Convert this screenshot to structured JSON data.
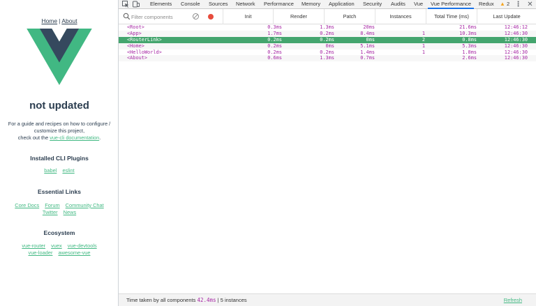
{
  "app": {
    "nav": {
      "home": "Home",
      "separator": "|",
      "about": "About"
    },
    "title": "not updated",
    "guide_line1": "For a guide and recipes on how to configure /",
    "guide_line2": "customize this project,",
    "guide_line3_prefix": "check out the",
    "guide_link": "vue-cli documentation",
    "guide_line3_suffix": ".",
    "plugins_heading": "Installed CLI Plugins",
    "plugins": [
      "babel",
      "eslint"
    ],
    "essential_heading": "Essential Links",
    "essential_row1": [
      "Core Docs",
      "Forum",
      "Community Chat"
    ],
    "essential_row2": [
      "Twitter",
      "News"
    ],
    "ecosystem_heading": "Ecosystem",
    "ecosystem_row1": [
      "vue-router",
      "vuex",
      "vue-devtools"
    ],
    "ecosystem_row2": [
      "vue-loader",
      "awesome-vue"
    ],
    "logo_colors": {
      "outer": "#41b883",
      "inner": "#35495e"
    }
  },
  "devtools": {
    "tabs": [
      "Elements",
      "Console",
      "Sources",
      "Network",
      "Performance",
      "Memory",
      "Application",
      "Security",
      "Audits",
      "Vue",
      "Vue Performance",
      "Redux"
    ],
    "active_tab": "Vue Performance",
    "warning_count": "2",
    "toolbar": {
      "filter_placeholder": "Filter components",
      "columns": [
        "Init",
        "Render",
        "Patch",
        "Instances",
        "Total Time (ms)",
        "Last Update"
      ]
    },
    "rows": [
      {
        "name": "<Root>",
        "init": "0.3ms",
        "render": "1.3ms",
        "patch": "20ms",
        "instances": "",
        "total": "21.6ms",
        "last": "12:46:12",
        "selected": false
      },
      {
        "name": "<App>",
        "init": "1.7ms",
        "render": "0.2ms",
        "patch": "8.4ms",
        "instances": "1",
        "total": "10.3ms",
        "last": "12:46:30",
        "selected": false
      },
      {
        "name": "<RouterLink>",
        "init": "0.2ms",
        "render": "0.2ms",
        "patch": "0ms",
        "instances": "2",
        "total": "0.8ms",
        "last": "12:46:30",
        "selected": true
      },
      {
        "name": "<Home>",
        "init": "0.2ms",
        "render": "0ms",
        "patch": "5.1ms",
        "instances": "1",
        "total": "5.3ms",
        "last": "12:46:30",
        "selected": false
      },
      {
        "name": "<HelloWorld>",
        "init": "0.2ms",
        "render": "0.2ms",
        "patch": "1.4ms",
        "instances": "1",
        "total": "1.8ms",
        "last": "12:46:30",
        "selected": false
      },
      {
        "name": "<About>",
        "init": "0.6ms",
        "render": "1.3ms",
        "patch": "0.7ms",
        "instances": "",
        "total": "2.6ms",
        "last": "12:46:30",
        "selected": false
      }
    ],
    "status": {
      "prefix": "Time taken by all components",
      "total": "42.4ms",
      "separator": "|",
      "instances": "5 instances",
      "refresh": "Refresh"
    },
    "colors": {
      "selected_row": "#44a56e",
      "component_text": "#a626a4",
      "active_tab_underline": "#1a73e8",
      "record": "#e74c3c",
      "link": "#42b983"
    },
    "icons": [
      "inspect-icon",
      "device-toggle-icon",
      "warning-icon",
      "more-vert-icon",
      "close-icon",
      "search-icon",
      "clear-icon",
      "record-icon"
    ]
  }
}
